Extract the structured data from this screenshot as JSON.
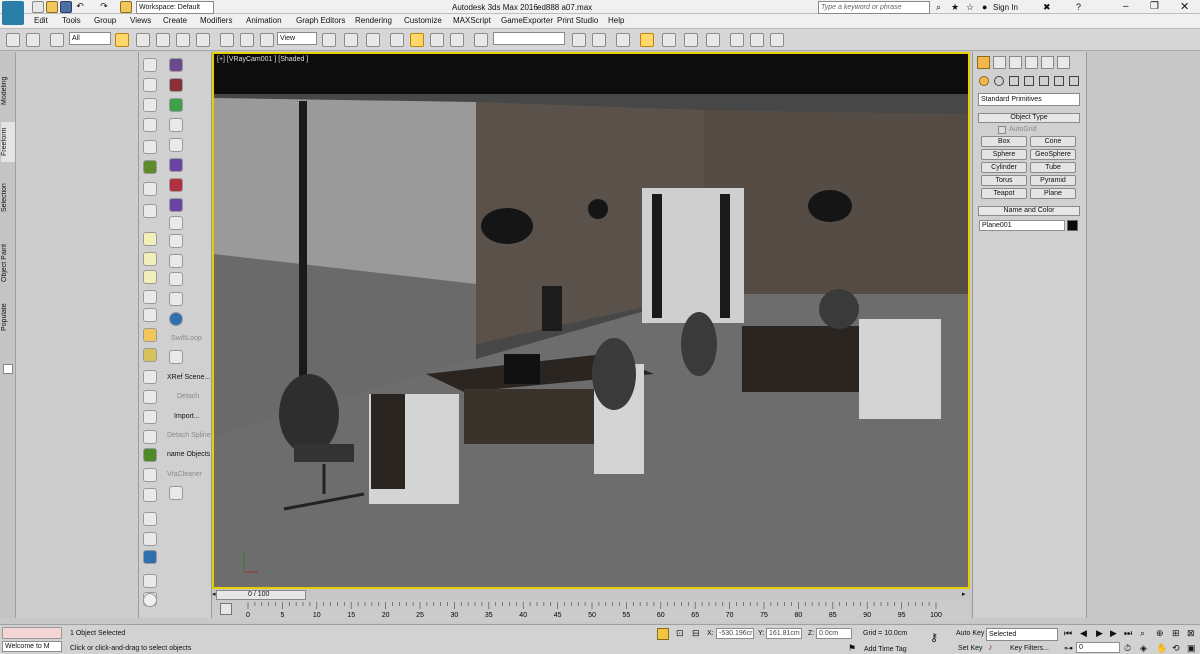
{
  "titlebar": {
    "workspace_label": "Workspace: Default",
    "app_title": "Autodesk 3ds Max 2016",
    "file_name": "ed888 a07.max",
    "search_placeholder": "Type a keyword or phrase",
    "signin": "Sign In"
  },
  "menu": [
    "Edit",
    "Tools",
    "Group",
    "Views",
    "Create",
    "Modifiers",
    "Animation",
    "Graph Editors",
    "Rendering",
    "Customize",
    "MAXScript",
    "GameExporter",
    "Print Studio",
    "Help"
  ],
  "toolbar": {
    "filter_value": "All",
    "refcoord_value": "View",
    "named_selection_value": ""
  },
  "left_tabs": [
    "Modeling",
    "Freeform",
    "Selection",
    "Object Paint",
    "Populate"
  ],
  "ribbon_labels": {
    "swiftloop": "SwiftLoop",
    "xref": "XRef Scene...",
    "detach": "Detach",
    "import": "Import...",
    "detach_spline": "Detach Spline",
    "name_objects": "name Objects",
    "vrcleaner": "VraCleaner"
  },
  "viewport": {
    "label": "[+] [VRayCam001 ] [Shaded ]"
  },
  "command_panel": {
    "category_value": "Standard Primitives",
    "object_type_header": "Object Type",
    "autogrid_label": "AutoGrid",
    "buttons": [
      "Box",
      "Cone",
      "Sphere",
      "GeoSphere",
      "Cylinder",
      "Tube",
      "Torus",
      "Pyramid",
      "Teapot",
      "Plane"
    ],
    "name_color_header": "Name and Color",
    "object_name": "Plane001"
  },
  "timeline": {
    "frame_label": "0 / 100",
    "ticks": [
      "0",
      "5",
      "10",
      "15",
      "20",
      "25",
      "30",
      "35",
      "40",
      "45",
      "50",
      "55",
      "60",
      "65",
      "70",
      "75",
      "80",
      "85",
      "90",
      "95",
      "100"
    ]
  },
  "status": {
    "maxscript_text": "Welcome to M",
    "selection_status": "1 Object Selected",
    "prompt": "Click or click-and-drag to select objects",
    "x_label": "X:",
    "x_value": "-530.196cr",
    "y_label": "Y:",
    "y_value": "161.81cm",
    "z_label": "Z:",
    "z_value": "0.0cm",
    "grid": "Grid = 10.0cm",
    "add_time_tag": "Add Time Tag",
    "autokey": "Auto Key",
    "setkey": "Set Key",
    "selected_value": "Selected",
    "key_filters": "Key Filters...",
    "frame_value": "0"
  }
}
